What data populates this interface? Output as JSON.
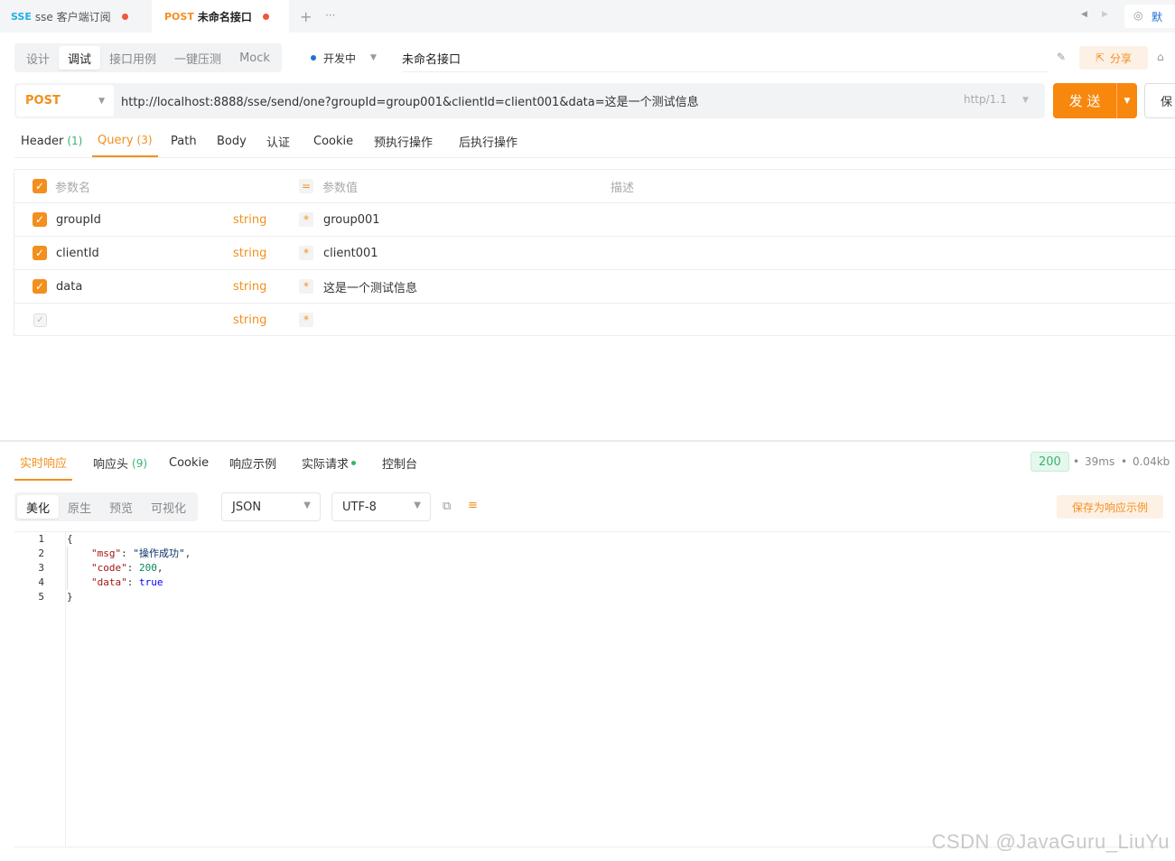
{
  "tabs": [
    {
      "tag": "SSE",
      "title": "sse 客户端订阅"
    },
    {
      "tag": "POST",
      "title": "未命名接口"
    }
  ],
  "env_label": "默",
  "mode_tabs": [
    "设计",
    "调试",
    "接口用例",
    "一键压测",
    "Mock"
  ],
  "status_text": "开发中",
  "api_name": "未命名接口",
  "share_label": "分享",
  "request": {
    "method": "POST",
    "url": "http://localhost:8888/sse/send/one?groupId=group001&clientId=client001&data=这是一个测试信息",
    "protocol": "http/1.1",
    "send_label": "发 送",
    "save_label": "保"
  },
  "sub_tabs": [
    {
      "label": "Header",
      "count": "(1)"
    },
    {
      "label": "Query",
      "count": "(3)"
    },
    {
      "label": "Path",
      "count": ""
    },
    {
      "label": "Body",
      "count": ""
    },
    {
      "label": "认证",
      "count": ""
    },
    {
      "label": "Cookie",
      "count": ""
    },
    {
      "label": "预执行操作",
      "count": ""
    },
    {
      "label": "后执行操作",
      "count": ""
    }
  ],
  "params_header": {
    "name": "参数名",
    "value": "参数值",
    "desc": "描述"
  },
  "params": [
    {
      "name": "groupId",
      "type": "string",
      "value": "group001"
    },
    {
      "name": "clientId",
      "type": "string",
      "value": "client001"
    },
    {
      "name": "data",
      "type": "string",
      "value": "这是一个测试信息"
    },
    {
      "name": "",
      "type": "string",
      "value": ""
    }
  ],
  "response_tabs": [
    {
      "label": "实时响应",
      "count": ""
    },
    {
      "label": "响应头",
      "count": "(9)"
    },
    {
      "label": "Cookie",
      "count": ""
    },
    {
      "label": "响应示例",
      "count": ""
    },
    {
      "label": "实际请求",
      "count": ""
    },
    {
      "label": "控制台",
      "count": ""
    }
  ],
  "response_meta": {
    "status": "200",
    "time": "39ms",
    "size": "0.04kb"
  },
  "view_tabs": [
    "美化",
    "原生",
    "预览",
    "可视化"
  ],
  "format_select": "JSON",
  "encoding_select": "UTF-8",
  "save_example_label": "保存为响应示例",
  "code": {
    "line_numbers": [
      "1",
      "2",
      "3",
      "4",
      "5"
    ],
    "open": "{",
    "close": "}",
    "msg_key": "\"msg\"",
    "msg_val": "\"操作成功\"",
    "code_key": "\"code\"",
    "code_val": "200",
    "data_key": "\"data\"",
    "data_val": "true"
  },
  "watermark": "CSDN @JavaGuru_LiuYu",
  "colors": {
    "accent": "#f38f1e",
    "success": "#37b56a",
    "sse": "#1fb0e6"
  }
}
